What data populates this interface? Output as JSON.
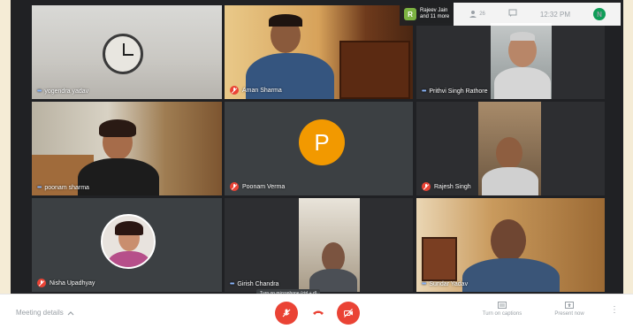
{
  "participants": {
    "yogendra": "yogendra yadav",
    "aman": "Aman Sharma",
    "prithvi": "Prithvi Singh Rathore",
    "poonam_s": "poonam sharma",
    "poonam_v": "Poonam Verma",
    "poonam_v_initial": "P",
    "rajesh": "Rajesh Singh",
    "nisha": "Nisha Upadhyay",
    "girish": "Girish Chandra",
    "sundar": "Sundar Yadav"
  },
  "top_bar": {
    "chip_initial": "R",
    "chip_line1": "Rajeev Jain",
    "chip_line2": "and 11 more",
    "people_count": "26",
    "clock": "12:32 PM",
    "self_initial": "N"
  },
  "bottom_bar": {
    "meeting_details": "Meeting details",
    "turn_on_captions": "Turn on captions",
    "present_now": "Present now",
    "tooltip": "Turn on microphone (ctrl + d)"
  },
  "colors": {
    "accent_red": "#ea4335",
    "avatar_orange": "#f29900",
    "grid_bg": "#202124"
  }
}
